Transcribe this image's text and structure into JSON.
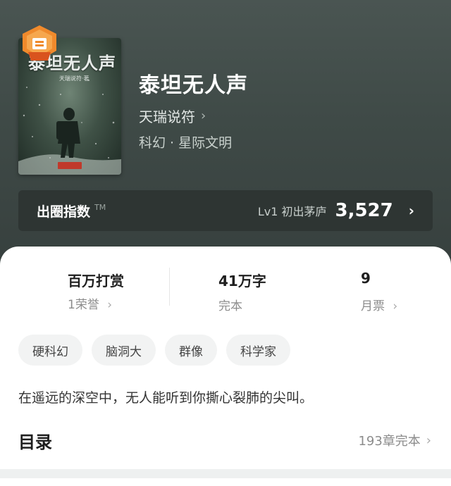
{
  "book": {
    "cover_title": "泰坦无人声",
    "cover_author": "天瑞说符·著",
    "title": "泰坦无人声",
    "author": "天瑞说符",
    "genre": "科幻 · 星际文明"
  },
  "index": {
    "label": "出圈指数",
    "tm": "TM",
    "level": "Lv1 初出茅庐",
    "score": "3,527"
  },
  "stats": {
    "award_title": "百万打赏",
    "award_sub": "1荣誉",
    "words_title": "41万字",
    "words_sub": "完本",
    "tickets_title": "9",
    "tickets_sub": "月票"
  },
  "tags": [
    "硬科幻",
    "脑洞大",
    "群像",
    "科学家"
  ],
  "description": "在遥远的深空中，无人能听到你撕心裂肺的尖叫。",
  "toc": {
    "title": "目录",
    "status": "193章完本"
  },
  "colors": {
    "hero_bg": "#3f4a47",
    "award_orange": "#f08a2c"
  },
  "icons": [
    "chevron-right-icon",
    "award-badge-icon"
  ]
}
